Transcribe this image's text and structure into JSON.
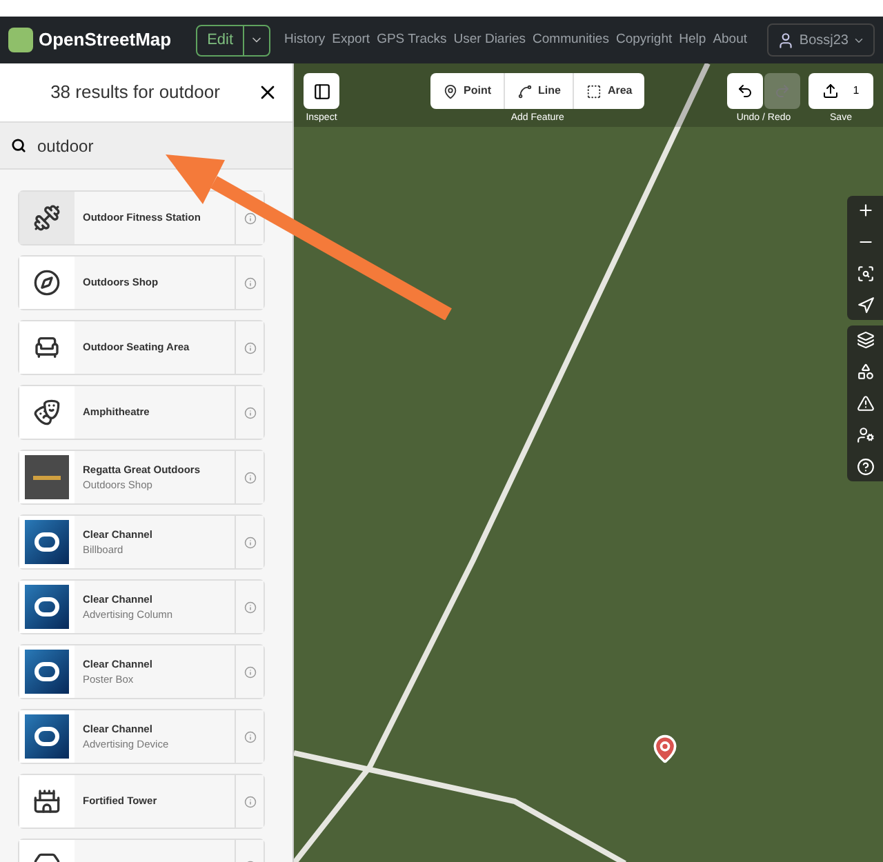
{
  "nav": {
    "brand": "OpenStreetMap",
    "edit_button": "Edit",
    "links": [
      "History",
      "Export",
      "GPS Tracks",
      "User Diaries",
      "Communities",
      "Copyright",
      "Help",
      "About"
    ],
    "user": "Bossj23"
  },
  "sidebar": {
    "title": "38 results for outdoor",
    "search": {
      "value": "outdoor"
    },
    "results": [
      {
        "name": "Outdoor Fitness Station",
        "kind": "fitness",
        "highlighted": true
      },
      {
        "name": "Outdoors Shop",
        "kind": "compass",
        "highlighted": false
      },
      {
        "name": "Outdoor Seating Area",
        "kind": "picnic",
        "highlighted": false
      },
      {
        "name": "Amphitheatre",
        "kind": "theatre",
        "highlighted": false
      },
      {
        "name": "Regatta Great Outdoors",
        "subtitle": "Outdoors Shop",
        "kind": "logodark",
        "highlighted": false
      },
      {
        "name": "Clear Channel",
        "subtitle": "Billboard",
        "kind": "logoblue",
        "highlighted": false
      },
      {
        "name": "Clear Channel",
        "subtitle": "Advertising Column",
        "kind": "logoblue",
        "highlighted": false
      },
      {
        "name": "Clear Channel",
        "subtitle": "Poster Box",
        "kind": "logoblue",
        "highlighted": false
      },
      {
        "name": "Clear Channel",
        "subtitle": "Advertising Device",
        "kind": "logoblue",
        "highlighted": false
      },
      {
        "name": "Fortified Tower",
        "kind": "tower",
        "highlighted": false
      },
      {
        "kind": "board",
        "highlighted": false
      }
    ]
  },
  "toolbar": {
    "inspect": "Inspect",
    "add_feature": "Add Feature",
    "modes": [
      "Point",
      "Line",
      "Area"
    ],
    "undo_redo": "Undo / Redo",
    "redo_disabled": true,
    "save": "Save",
    "save_count": "1"
  }
}
